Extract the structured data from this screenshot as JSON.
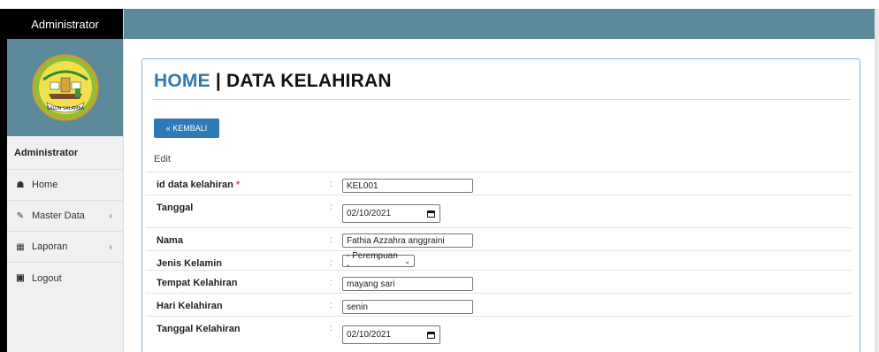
{
  "sidebar": {
    "brand": "Administrator",
    "user_label": "Administrator",
    "items": [
      {
        "label": "Home",
        "icon": "home-icon"
      },
      {
        "label": "Master Data",
        "icon": "edit-icon"
      },
      {
        "label": "Laporan",
        "icon": "calendar-icon"
      },
      {
        "label": "Logout",
        "icon": "logout-icon"
      }
    ]
  },
  "logo": {
    "text": "SALUN SALAMBA"
  },
  "main": {
    "title_home": "HOME",
    "title_sep": " | ",
    "title_rest": "DATA KELAHIRAN",
    "back_button": "« KEMBALI",
    "edit_label": "Edit"
  },
  "form": {
    "id": {
      "label": "id data kelahiran",
      "required": "*",
      "value": "KEL001"
    },
    "tanggal": {
      "label": "Tanggal",
      "value": "02/10/2021"
    },
    "nama": {
      "label": "Nama",
      "value": "Fathia Azzahra anggraini"
    },
    "jenis_kelamin": {
      "label": "Jenis Kelamin",
      "value": "- Perempuan -"
    },
    "tempat": {
      "label": "Tempat Kelahiran",
      "value": "mayang sari"
    },
    "hari": {
      "label": "Hari Kelahiran",
      "value": "senin"
    },
    "tanggal_kelahiran": {
      "label": "Tanggal Kelahiran",
      "value": "02/10/2021"
    }
  },
  "colors": {
    "primary": "#2f7ab6",
    "topbar": "#5c8a9a",
    "sidebar_bg": "#f0f0f0"
  }
}
